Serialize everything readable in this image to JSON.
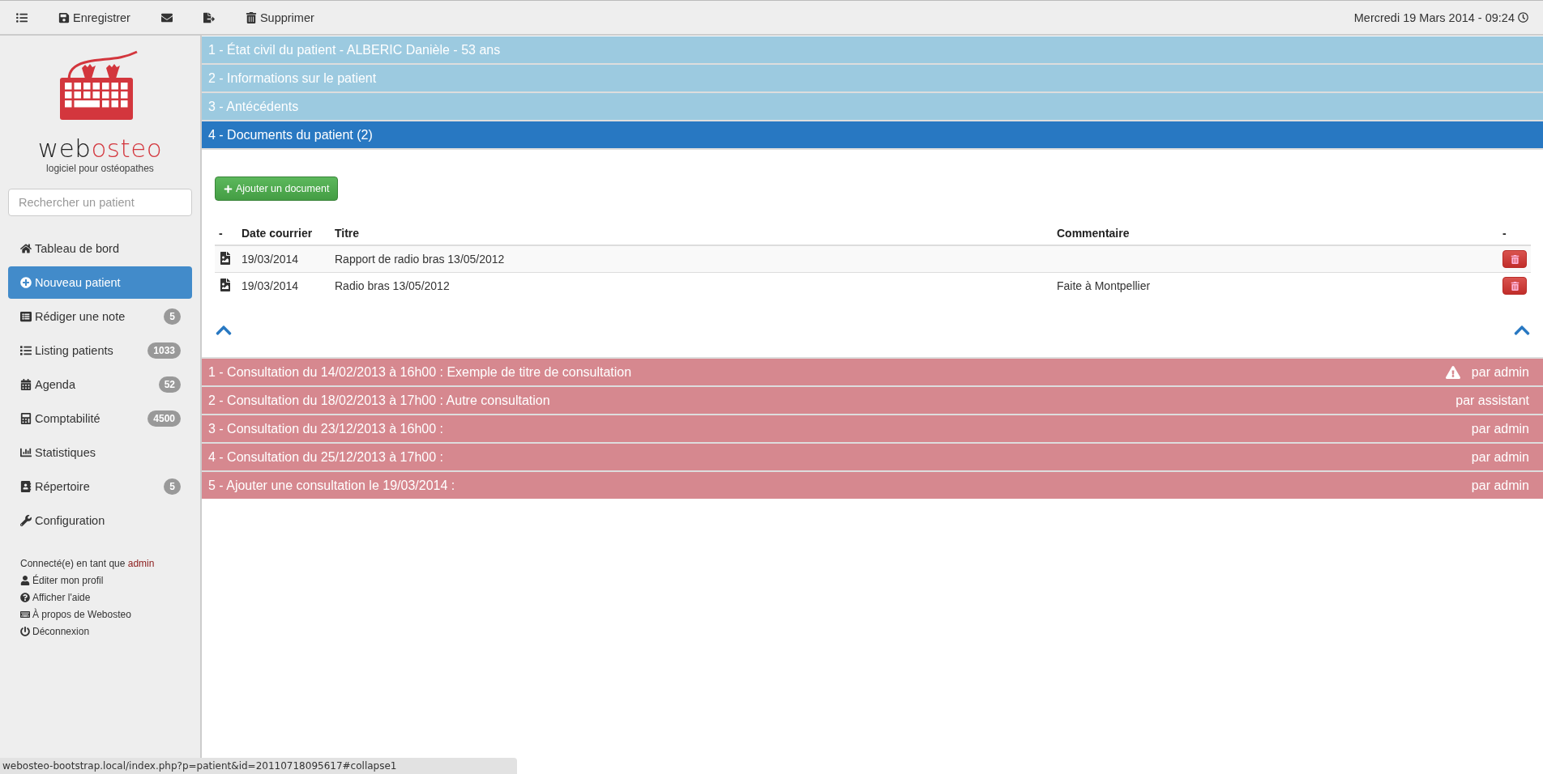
{
  "toolbar": [
    {
      "kind": "icon"
    },
    {
      "kind": "labeled",
      "label": "Enregistrer"
    },
    {
      "kind": "icon"
    },
    {
      "kind": "icon"
    },
    {
      "kind": "labeled",
      "label": "Supprimer"
    }
  ],
  "datetime": "Mercredi 19 Mars 2014 - 09:24",
  "logo": {
    "name_dark": "web",
    "name_accent": "osteo",
    "tagline": "logiciel pour ostéopathes"
  },
  "search": {
    "placeholder": "Rechercher un patient"
  },
  "sidebar": {
    "items": [
      {
        "label": "Tableau de bord",
        "selected": false
      },
      {
        "label": "Nouveau patient",
        "selected": true
      },
      {
        "label": "Rédiger une note",
        "badge": "5",
        "selected": false
      },
      {
        "label": "Listing patients",
        "badge": "1033",
        "selected": false
      },
      {
        "label": "Agenda",
        "badge": "52",
        "selected": false
      },
      {
        "label": "Comptabilité",
        "badge": "4500",
        "selected": false
      },
      {
        "label": "Statistiques",
        "selected": false
      },
      {
        "label": "Répertoire",
        "badge": "5",
        "selected": false
      },
      {
        "label": "Configuration",
        "selected": false
      }
    ],
    "user": {
      "prefix": "Connecté(e) en tant que",
      "name": "admin"
    },
    "links": [
      "Éditer mon profil",
      "Afficher l'aide",
      "À propos de Webosteo",
      "Déconnexion"
    ]
  },
  "sections": [
    {
      "label": "1 - État civil du patient - ALBERIC Danièle - 53 ans",
      "selected": false
    },
    {
      "label": "2 - Informations sur le patient",
      "selected": false
    },
    {
      "label": "3 - Antécédents",
      "selected": false
    },
    {
      "label": "4 - Documents du patient (2)",
      "selected": true
    }
  ],
  "documents": {
    "add_button": "Ajouter un document",
    "columns": [
      "-",
      "Date courrier",
      "Titre",
      "Commentaire",
      "-"
    ],
    "rows": [
      {
        "date": "19/03/2014",
        "title": "Rapport de radio bras 13/05/2012"
      },
      {
        "date": "19/03/2014",
        "title": "Radio bras 13/05/2012",
        "comment": "Faite à Montpellier"
      }
    ]
  },
  "consultations": [
    {
      "label": "1 - Consultation du 14/02/2013 à 16h00 : Exemple de titre de consultation",
      "author": "par admin",
      "warning": true
    },
    {
      "label": "2 - Consultation du 18/02/2013 à 17h00 : Autre consultation",
      "author": "par assistant",
      "warning": false
    },
    {
      "label": "3 - Consultation du 23/12/2013 à 16h00 :",
      "author": "par admin",
      "warning": false
    },
    {
      "label": "4 - Consultation du 25/12/2013 à 17h00 :",
      "author": "par admin",
      "warning": false
    },
    {
      "label": "5 - Ajouter une consultation le 19/03/2014 :",
      "author": "par admin",
      "warning": false
    }
  ],
  "status_bar": "webosteo-bootstrap.local/index.php?p=patient&id=20110718095617#collapse1"
}
